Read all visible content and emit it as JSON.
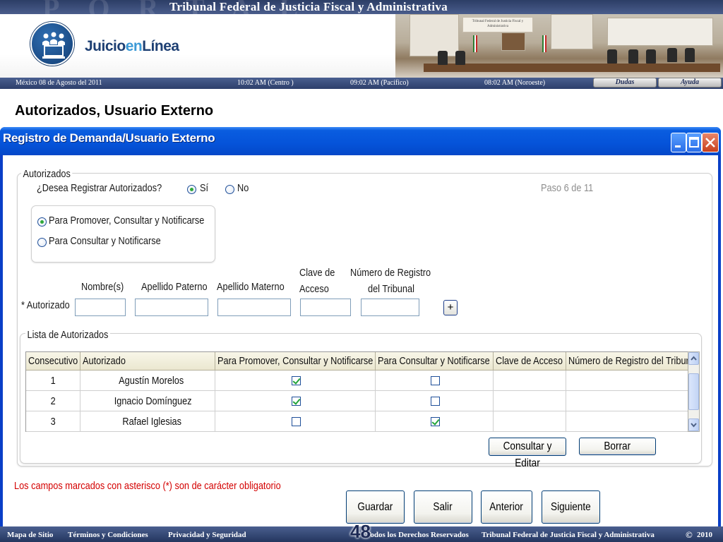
{
  "header": {
    "banner_watermark": "PORTAL",
    "banner_title": "Tribunal Federal de Justicia Fiscal y Administrativa",
    "logo_text_part1": "Juicio",
    "logo_text_part2": "en",
    "logo_text_part3": "Línea",
    "photo_sign_text": "Tribunal Federal de Justicia Fiscal y Administrativa",
    "date": "México 08 de Agosto del 2011",
    "time_centro": "10:02  AM (Centro )",
    "time_pacifico": "09:02 AM  (Pacífico)",
    "time_noroeste": "08:02 AM (Noroeste)",
    "dudas_label": "Dudas",
    "ayuda_label": "Ayuda"
  },
  "page_heading": "Autorizados, Usuario Externo",
  "window": {
    "title": "Registro de Demanda/Usuario Externo",
    "authorized_frame": {
      "legend": "Autorizados",
      "question": "¿Desea Registrar Autorizados?",
      "option_yes": "Sí",
      "option_no": "No",
      "selected": "Sí",
      "step": "Paso 6 de 11",
      "permission_options": [
        "Para Promover, Consultar y Notificarse",
        "Para Consultar y Notificarse"
      ],
      "permission_selected": "Para Promover, Consultar y Notificarse"
    },
    "form": {
      "row_label": "* Autorizado",
      "col_nombre": "Nombre(s)",
      "col_paterno": "Apellido Paterno",
      "col_materno": "Apellido Materno",
      "col_clave_line1": "Clave de",
      "col_clave_line2": "Acceso",
      "col_registro_line1": "Número de Registro",
      "col_registro_line2": "del Tribunal",
      "add_button": "+"
    },
    "list_frame": {
      "legend": "Lista de Autorizados",
      "columns": [
        "Consecutivo",
        "Autorizado",
        "Para Promover, Consultar y Notificarse",
        "Para Consultar y Notificarse",
        "Clave de Acceso",
        "Número de Registro del Tribunal"
      ],
      "rows": [
        {
          "consecutivo": "1",
          "autorizado": "Agustín Morelos",
          "promover": true,
          "consultar": false,
          "clave": "",
          "registro": ""
        },
        {
          "consecutivo": "2",
          "autorizado": "Ignacio Domínguez",
          "promover": true,
          "consultar": false,
          "clave": "",
          "registro": ""
        },
        {
          "consecutivo": "3",
          "autorizado": "Rafael Iglesias",
          "promover": false,
          "consultar": true,
          "clave": "",
          "registro": ""
        }
      ],
      "edit_button": "Consultar y Editar",
      "delete_button": "Borrar"
    },
    "required_note": "Los campos marcados con asterisco (*) son de carácter obligatorio",
    "nav_buttons": {
      "save": "Guardar",
      "exit": "Salir",
      "previous": "Anterior",
      "next": "Siguiente"
    }
  },
  "footer": {
    "site_map": "Mapa de Sitio",
    "terms": "Términos y Condiciones",
    "privacy": "Privacidad y Seguridad",
    "rights": "Todos los Derechos Reservados",
    "tribunal": "Tribunal Federal de Justicia Fiscal y Administrativa",
    "copyright_symbol": "©",
    "year": "2010",
    "slide_number": "48"
  },
  "icons": {
    "logo": "people-at-computer-icon",
    "scroll_up": "chevron-up-icon",
    "scroll_down": "chevron-down-icon",
    "minimize": "minimize-icon",
    "maximize": "maximize-icon",
    "close": "close-icon"
  },
  "colors": {
    "titlebar_blue": "#0553d9",
    "brand_navy": "#1d3f73",
    "required_red": "#d40000",
    "check_green": "#23a43a"
  }
}
